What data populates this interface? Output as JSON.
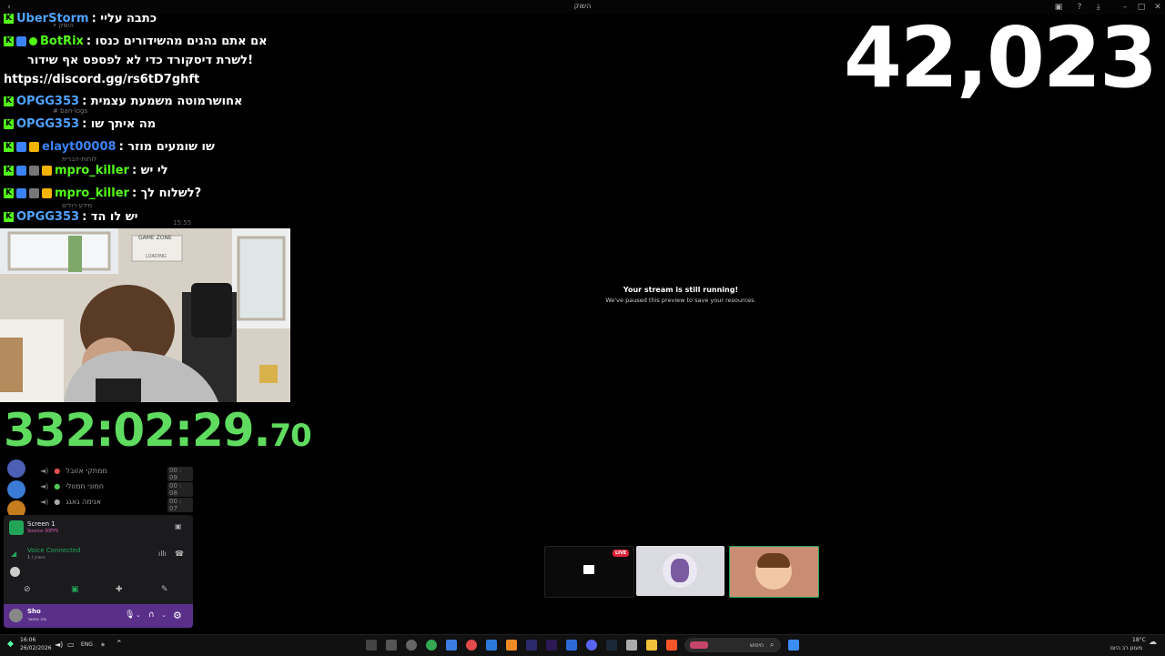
{
  "window": {
    "title": "השוק"
  },
  "counter": {
    "value": "42,023"
  },
  "chat": {
    "lines": [
      {
        "user": "UberStorm",
        "user_color": "#4fa3ff",
        "text": ": כתבה עליי"
      },
      {
        "user": "BotRix",
        "user_color": "#53fc18",
        "text": ": אם אתם נהנים מהשידורים כנסו"
      },
      {
        "user": "",
        "user_color": "#fff",
        "text": "לשרת דיסקורד כדי לא לפספס אף שידור!"
      },
      {
        "user": "",
        "user_color": "#fff",
        "text": "https://discord.gg/rs6tD7ghft"
      },
      {
        "user": "OPGG353",
        "user_color": "#4fa3ff",
        "text": ": אחושרמוטה משמעת עצמית"
      },
      {
        "user": "OPGG353",
        "user_color": "#4fa3ff",
        "text": ": מה איתך שו"
      },
      {
        "user": "elayt00008",
        "user_color": "#3b82f6",
        "text": ": שו שומעים מוזר"
      },
      {
        "user": "mpro_killer",
        "user_color": "#53fc18",
        "text": ": לי יש"
      },
      {
        "user": "mpro_killer",
        "user_color": "#53fc18",
        "text": ": לשלוח לך?"
      },
      {
        "user": "OPGG353",
        "user_color": "#4fa3ff",
        "text": ": יש לו הד"
      }
    ]
  },
  "webcam": {
    "sign_text": "GAME ZONE",
    "sign_sub": "LOADING"
  },
  "timer": {
    "main": "332:02:29.",
    "ms": "70"
  },
  "discord": {
    "voice_users": [
      {
        "name": "ממתקי אזובל",
        "time": "00 : 09"
      },
      {
        "name": "חמוני חמוולי",
        "time": "00 : 08"
      },
      {
        "name": "אנימה גאגג",
        "time": "00 : 07"
      }
    ],
    "stream": {
      "title": "Screen 1",
      "sub": "Source 30FPS"
    },
    "voice": {
      "status": "Voice Connected",
      "channel": "השוק / 1"
    },
    "user": {
      "name": "Sho",
      "status": "מה אפשר"
    }
  },
  "preview": {
    "title": "Your stream is still running!",
    "subtitle": "We've paused this preview to save your resources."
  },
  "thumbnails": {
    "live_badge": "LIVE"
  },
  "taskbar": {
    "time": "16:06",
    "date": "26/02/2026",
    "lang": "ENG",
    "search_placeholder": "חיפוש",
    "weather_temp": "18°C",
    "weather_desc": "מעונן רב היום"
  },
  "colors": {
    "accent_green": "#53fc18",
    "timer_green": "#5fdc5f",
    "discord_purple": "#5a2f8a"
  }
}
